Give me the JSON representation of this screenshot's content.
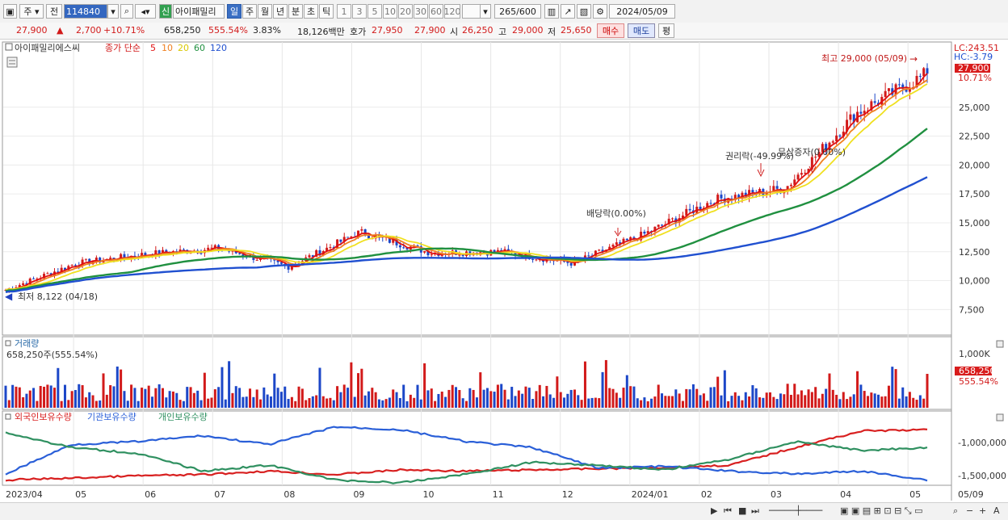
{
  "toolbar": {
    "period_type": "주",
    "market_label": "전",
    "stock_code": "114840",
    "credit_badge": "신",
    "stock_name": "아이패밀리",
    "periods": [
      "일",
      "주",
      "월",
      "년",
      "분",
      "초",
      "틱"
    ],
    "active_period": "일",
    "minute_options": [
      "1",
      "3",
      "5",
      "10",
      "20",
      "30",
      "60",
      "120"
    ],
    "count_display": "265/600",
    "date": "2024/05/09"
  },
  "quote": {
    "price": "27,900",
    "change": "2,700",
    "change_rate": "+10.71%",
    "volume": "658,250",
    "volume_ratio": "555.54%",
    "turnover": "3.83%",
    "amount": "18,126백만",
    "ask_label": "호가",
    "ask": "27,950",
    "bid": "27,900",
    "open_label": "시",
    "open": "26,250",
    "high_label": "고",
    "high": "29,000",
    "low_label": "저",
    "low": "25,650",
    "buy_button": "매수",
    "sell_button": "매도",
    "eval_button": "평"
  },
  "price_panel": {
    "title": "아이패밀리에스씨",
    "ma_label": "종가 단순",
    "ma_periods": [
      "5",
      "10",
      "20",
      "60",
      "120"
    ],
    "ma_colors": [
      "#e01010",
      "#f08020",
      "#f0e020",
      "#209040",
      "#2050d0"
    ],
    "lc": "LC:243.51",
    "hc": "HC:-3.79",
    "current_price_tag": "27,900",
    "current_pct_tag": "10.71%",
    "y_ticks": [
      "25,000",
      "22,500",
      "20,000",
      "17,500",
      "15,000",
      "12,500",
      "10,000",
      "7,500"
    ],
    "high_note": "최고 29,000 (05/09)",
    "low_note": "최저 8,122 (04/18)",
    "events": [
      "배당락(0.00%)",
      "권리락(-49.99%)",
      "무상증자(0.00%)"
    ]
  },
  "volume_panel": {
    "title": "거래량",
    "value_label": "658,250주(555.54%)",
    "y_tick": "1,000K",
    "tag_value": "658,250",
    "tag_pct": "555.54%"
  },
  "holdings_panel": {
    "series": [
      "외국인보유수량",
      "기관보유수량",
      "개인보유수량"
    ],
    "colors": [
      "#d82020",
      "#2a5fd8",
      "#2f9060"
    ],
    "y_ticks": [
      "-1,000,000",
      "-1,500,000"
    ]
  },
  "x_axis": {
    "labels": [
      "2023/04",
      "05",
      "06",
      "07",
      "08",
      "09",
      "10",
      "11",
      "12",
      "2024/01",
      "02",
      "03",
      "04",
      "05"
    ],
    "right_label": "05/09"
  },
  "chart_data": {
    "type": "candlestick",
    "title": "아이패밀리에스씨",
    "ylim": [
      5500,
      30500
    ],
    "monthly_close": [
      {
        "x": "2023/04",
        "y": 9200
      },
      {
        "x": "2023/05",
        "y": 11500
      },
      {
        "x": "2023/06",
        "y": 12300
      },
      {
        "x": "2023/07",
        "y": 12800
      },
      {
        "x": "2023/08",
        "y": 11200
      },
      {
        "x": "2023/09",
        "y": 14200
      },
      {
        "x": "2023/10",
        "y": 12400
      },
      {
        "x": "2023/11",
        "y": 12500
      },
      {
        "x": "2023/12",
        "y": 11500
      },
      {
        "x": "2024/01",
        "y": 14000
      },
      {
        "x": "2024/02",
        "y": 17000
      },
      {
        "x": "2024/03",
        "y": 18000
      },
      {
        "x": "2024/04",
        "y": 24500
      },
      {
        "x": "2024/05",
        "y": 27900
      }
    ],
    "last_close": 27900,
    "high": {
      "value": 29000,
      "date": "05/09"
    },
    "low": {
      "value": 8122,
      "date": "04/18"
    }
  }
}
